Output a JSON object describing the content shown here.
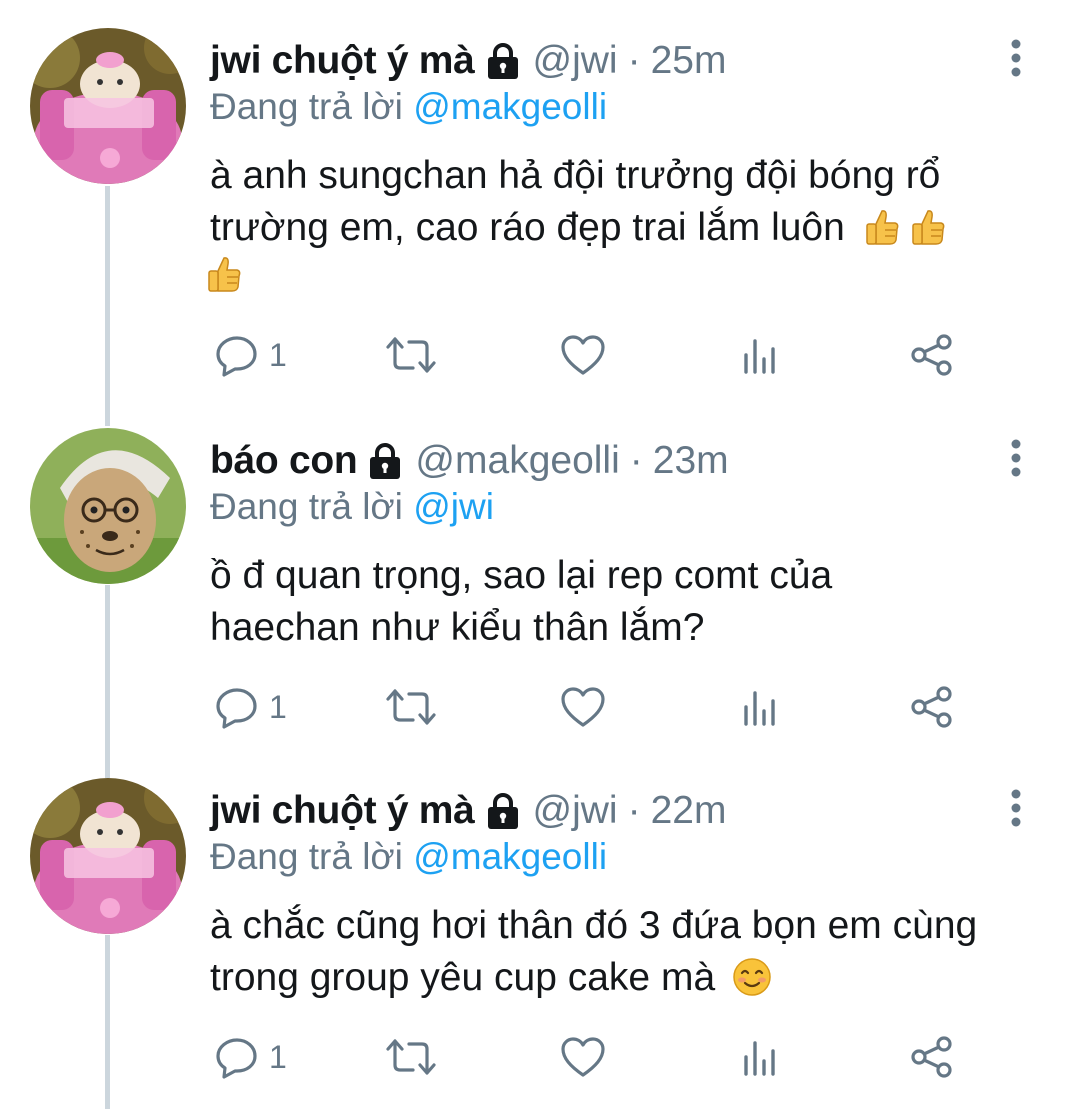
{
  "tweets": [
    {
      "name": "jwi chuột ý mà",
      "handle": "@jwi",
      "separator": "·",
      "time": "25m",
      "reply_prefix": "Đang trả lời",
      "reply_mention": "@makgeolli",
      "text": "à anh sungchan hả đội trưởng đội bóng rổ trường em, cao ráo đẹp trai lắm luôn",
      "emojis": [
        "thumbs-up",
        "thumbs-up",
        "thumbs-up"
      ],
      "reply_count": "1",
      "avatar": "hamster-in-pink-car"
    },
    {
      "name": "báo con",
      "handle": "@makgeolli",
      "separator": "·",
      "time": "23m",
      "reply_prefix": "Đang trả lời",
      "reply_mention": "@jwi",
      "text": "ồ đ quan trọng, sao lại rep comt của haechan như kiểu thân lắm?",
      "emojis": [],
      "reply_count": "1",
      "avatar": "cheetah-cub-with-cap"
    },
    {
      "name": "jwi chuột ý mà",
      "handle": "@jwi",
      "separator": "·",
      "time": "22m",
      "reply_prefix": "Đang trả lời",
      "reply_mention": "@makgeolli",
      "text": "à chắc cũng hơi thân đó 3 đứa bọn em cùng trong group yêu cup cake mà",
      "emojis": [
        "smiling-face"
      ],
      "reply_count": "1",
      "avatar": "hamster-in-pink-car"
    }
  ],
  "icons": {
    "lock": "lock-icon",
    "more": "more-vertical-icon",
    "reply": "reply-icon",
    "retweet": "retweet-icon",
    "like": "like-icon",
    "analytics": "analytics-icon",
    "share": "share-icon"
  },
  "colors": {
    "text": "#14171a",
    "muted": "#657786",
    "link": "#1da1f2",
    "thread_line": "#ccd6dd"
  }
}
